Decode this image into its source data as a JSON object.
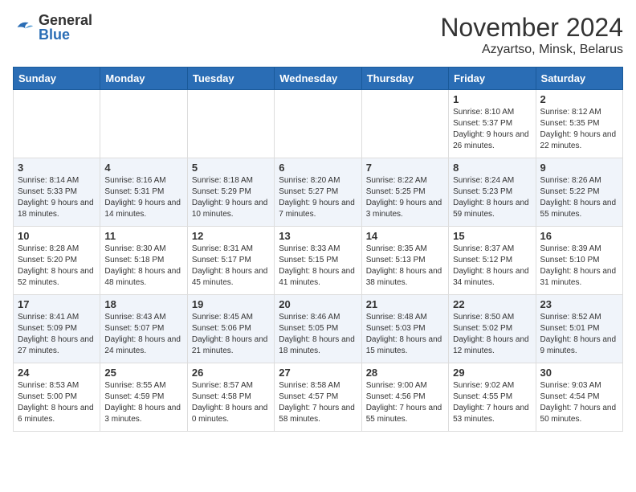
{
  "header": {
    "logo_general": "General",
    "logo_blue": "Blue",
    "title": "November 2024",
    "subtitle": "Azyartso, Minsk, Belarus"
  },
  "days_of_week": [
    "Sunday",
    "Monday",
    "Tuesday",
    "Wednesday",
    "Thursday",
    "Friday",
    "Saturday"
  ],
  "weeks": [
    [
      {
        "day": "",
        "info": ""
      },
      {
        "day": "",
        "info": ""
      },
      {
        "day": "",
        "info": ""
      },
      {
        "day": "",
        "info": ""
      },
      {
        "day": "",
        "info": ""
      },
      {
        "day": "1",
        "info": "Sunrise: 8:10 AM\nSunset: 5:37 PM\nDaylight: 9 hours and 26 minutes."
      },
      {
        "day": "2",
        "info": "Sunrise: 8:12 AM\nSunset: 5:35 PM\nDaylight: 9 hours and 22 minutes."
      }
    ],
    [
      {
        "day": "3",
        "info": "Sunrise: 8:14 AM\nSunset: 5:33 PM\nDaylight: 9 hours and 18 minutes."
      },
      {
        "day": "4",
        "info": "Sunrise: 8:16 AM\nSunset: 5:31 PM\nDaylight: 9 hours and 14 minutes."
      },
      {
        "day": "5",
        "info": "Sunrise: 8:18 AM\nSunset: 5:29 PM\nDaylight: 9 hours and 10 minutes."
      },
      {
        "day": "6",
        "info": "Sunrise: 8:20 AM\nSunset: 5:27 PM\nDaylight: 9 hours and 7 minutes."
      },
      {
        "day": "7",
        "info": "Sunrise: 8:22 AM\nSunset: 5:25 PM\nDaylight: 9 hours and 3 minutes."
      },
      {
        "day": "8",
        "info": "Sunrise: 8:24 AM\nSunset: 5:23 PM\nDaylight: 8 hours and 59 minutes."
      },
      {
        "day": "9",
        "info": "Sunrise: 8:26 AM\nSunset: 5:22 PM\nDaylight: 8 hours and 55 minutes."
      }
    ],
    [
      {
        "day": "10",
        "info": "Sunrise: 8:28 AM\nSunset: 5:20 PM\nDaylight: 8 hours and 52 minutes."
      },
      {
        "day": "11",
        "info": "Sunrise: 8:30 AM\nSunset: 5:18 PM\nDaylight: 8 hours and 48 minutes."
      },
      {
        "day": "12",
        "info": "Sunrise: 8:31 AM\nSunset: 5:17 PM\nDaylight: 8 hours and 45 minutes."
      },
      {
        "day": "13",
        "info": "Sunrise: 8:33 AM\nSunset: 5:15 PM\nDaylight: 8 hours and 41 minutes."
      },
      {
        "day": "14",
        "info": "Sunrise: 8:35 AM\nSunset: 5:13 PM\nDaylight: 8 hours and 38 minutes."
      },
      {
        "day": "15",
        "info": "Sunrise: 8:37 AM\nSunset: 5:12 PM\nDaylight: 8 hours and 34 minutes."
      },
      {
        "day": "16",
        "info": "Sunrise: 8:39 AM\nSunset: 5:10 PM\nDaylight: 8 hours and 31 minutes."
      }
    ],
    [
      {
        "day": "17",
        "info": "Sunrise: 8:41 AM\nSunset: 5:09 PM\nDaylight: 8 hours and 27 minutes."
      },
      {
        "day": "18",
        "info": "Sunrise: 8:43 AM\nSunset: 5:07 PM\nDaylight: 8 hours and 24 minutes."
      },
      {
        "day": "19",
        "info": "Sunrise: 8:45 AM\nSunset: 5:06 PM\nDaylight: 8 hours and 21 minutes."
      },
      {
        "day": "20",
        "info": "Sunrise: 8:46 AM\nSunset: 5:05 PM\nDaylight: 8 hours and 18 minutes."
      },
      {
        "day": "21",
        "info": "Sunrise: 8:48 AM\nSunset: 5:03 PM\nDaylight: 8 hours and 15 minutes."
      },
      {
        "day": "22",
        "info": "Sunrise: 8:50 AM\nSunset: 5:02 PM\nDaylight: 8 hours and 12 minutes."
      },
      {
        "day": "23",
        "info": "Sunrise: 8:52 AM\nSunset: 5:01 PM\nDaylight: 8 hours and 9 minutes."
      }
    ],
    [
      {
        "day": "24",
        "info": "Sunrise: 8:53 AM\nSunset: 5:00 PM\nDaylight: 8 hours and 6 minutes."
      },
      {
        "day": "25",
        "info": "Sunrise: 8:55 AM\nSunset: 4:59 PM\nDaylight: 8 hours and 3 minutes."
      },
      {
        "day": "26",
        "info": "Sunrise: 8:57 AM\nSunset: 4:58 PM\nDaylight: 8 hours and 0 minutes."
      },
      {
        "day": "27",
        "info": "Sunrise: 8:58 AM\nSunset: 4:57 PM\nDaylight: 7 hours and 58 minutes."
      },
      {
        "day": "28",
        "info": "Sunrise: 9:00 AM\nSunset: 4:56 PM\nDaylight: 7 hours and 55 minutes."
      },
      {
        "day": "29",
        "info": "Sunrise: 9:02 AM\nSunset: 4:55 PM\nDaylight: 7 hours and 53 minutes."
      },
      {
        "day": "30",
        "info": "Sunrise: 9:03 AM\nSunset: 4:54 PM\nDaylight: 7 hours and 50 minutes."
      }
    ]
  ]
}
